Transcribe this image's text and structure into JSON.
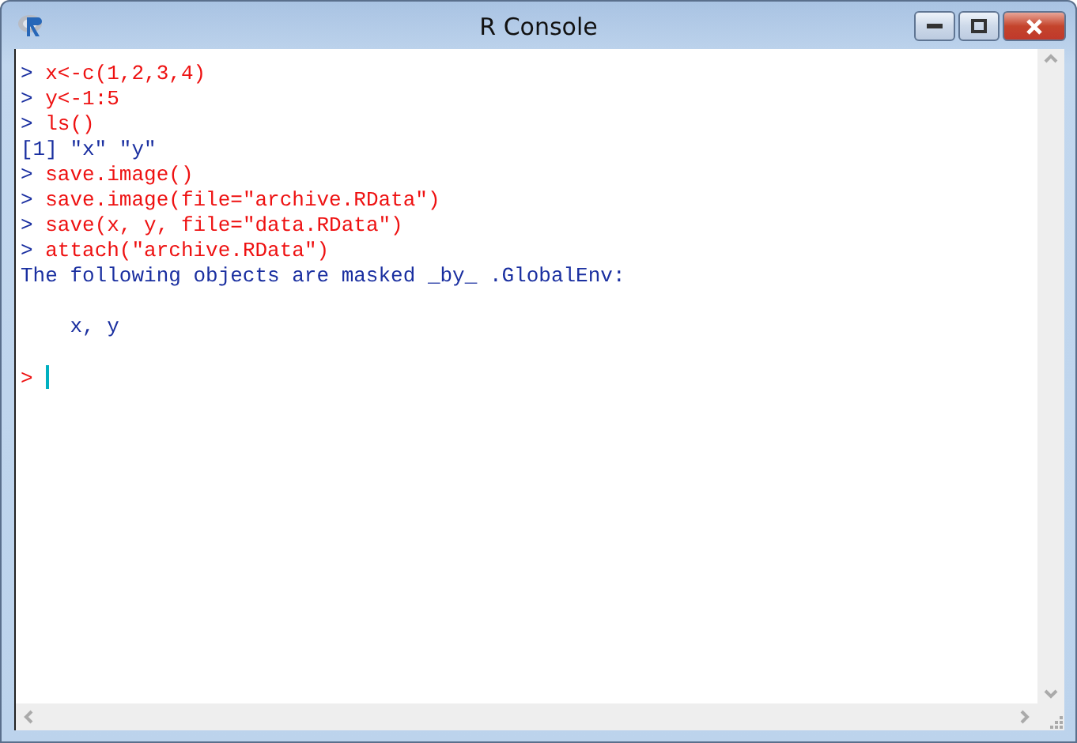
{
  "window": {
    "title": "R Console"
  },
  "console": {
    "lines": [
      {
        "kind": "input",
        "prompt": ">",
        "text": "x<-c(1,2,3,4)"
      },
      {
        "kind": "input",
        "prompt": ">",
        "text": "y<-1:5"
      },
      {
        "kind": "input",
        "prompt": ">",
        "text": "ls()"
      },
      {
        "kind": "output",
        "text": "[1] \"x\" \"y\""
      },
      {
        "kind": "input",
        "prompt": ">",
        "text": "save.image()"
      },
      {
        "kind": "input",
        "prompt": ">",
        "text": "save.image(file=\"archive.RData\")"
      },
      {
        "kind": "input",
        "prompt": ">",
        "text": "save(x, y, file=\"data.RData\")"
      },
      {
        "kind": "input",
        "prompt": ">",
        "text": "attach(\"archive.RData\")"
      },
      {
        "kind": "output",
        "text": "The following objects are masked _by_ .GlobalEnv:"
      },
      {
        "kind": "blank"
      },
      {
        "kind": "output",
        "text": "    x, y"
      },
      {
        "kind": "blank"
      },
      {
        "kind": "prompt",
        "prompt": ">"
      }
    ]
  }
}
